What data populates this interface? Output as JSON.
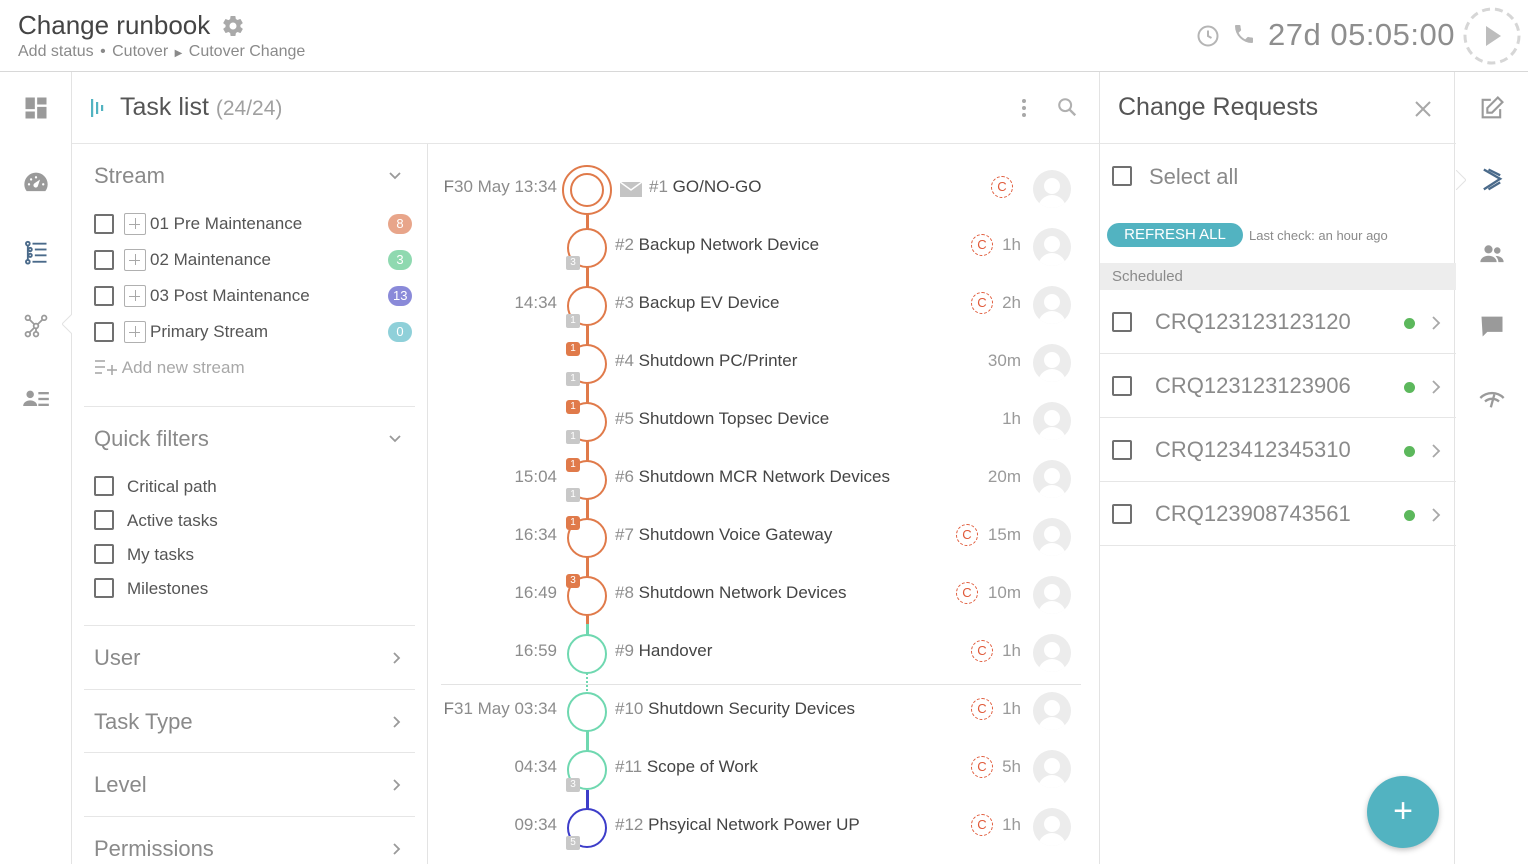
{
  "header": {
    "title": "Change runbook",
    "breadcrumb": [
      "Add status",
      "Cutover",
      "Cutover Change"
    ],
    "timer": "27d 05:05:00"
  },
  "tasklist": {
    "title": "Task list",
    "count": "(24/24)"
  },
  "filters": {
    "stream_title": "Stream",
    "streams": [
      {
        "label": "01 Pre Maintenance",
        "count": "8",
        "color": "#e8a58a"
      },
      {
        "label": "02 Maintenance",
        "count": "3",
        "color": "#8fd9b0"
      },
      {
        "label": "03 Post Maintenance",
        "count": "13",
        "color": "#8a8ad9"
      },
      {
        "label": "Primary Stream",
        "count": "0",
        "color": "#8fd0d9"
      }
    ],
    "add_stream": "Add new stream",
    "quick_title": "Quick filters",
    "quick": [
      "Critical path",
      "Active tasks",
      "My tasks",
      "Milestones"
    ],
    "sections": [
      "User",
      "Task Type",
      "Level",
      "Permissions"
    ]
  },
  "tasks": [
    {
      "date": "F",
      "time": "30 May 13:34",
      "num": "#1",
      "name": "GO/NO-GO",
      "dur": "",
      "c": true
    },
    {
      "date": "",
      "time": "",
      "num": "#2",
      "name": "Backup Network Device",
      "dur": "1h",
      "c": true
    },
    {
      "date": "",
      "time": "14:34",
      "num": "#3",
      "name": "Backup EV Device",
      "dur": "2h",
      "c": true
    },
    {
      "date": "",
      "time": "",
      "num": "#4",
      "name": "Shutdown PC/Printer",
      "dur": "30m",
      "c": false
    },
    {
      "date": "",
      "time": "",
      "num": "#5",
      "name": "Shutdown Topsec Device",
      "dur": "1h",
      "c": false
    },
    {
      "date": "",
      "time": "15:04",
      "num": "#6",
      "name": "Shutdown MCR Network Devices",
      "dur": "20m",
      "c": false
    },
    {
      "date": "",
      "time": "16:34",
      "num": "#7",
      "name": "Shutdown Voice Gateway",
      "dur": "15m",
      "c": true
    },
    {
      "date": "",
      "time": "16:49",
      "num": "#8",
      "name": "Shutdown Network Devices",
      "dur": "10m",
      "c": true
    },
    {
      "date": "",
      "time": "16:59",
      "num": "#9",
      "name": "Handover",
      "dur": "1h",
      "c": true
    },
    {
      "date": "F",
      "time": "31 May 03:34",
      "num": "#10",
      "name": "Shutdown Security Devices",
      "dur": "1h",
      "c": true
    },
    {
      "date": "",
      "time": "04:34",
      "num": "#11",
      "name": "Scope of Work",
      "dur": "5h",
      "c": true
    },
    {
      "date": "",
      "time": "09:34",
      "num": "#12",
      "name": "Phsyical Network Power UP",
      "dur": "1h",
      "c": true
    }
  ],
  "task_badges": {
    "r2": "3",
    "r3": "1",
    "r4a": "1",
    "r4b": "1",
    "r5a": "1",
    "r5b": "1",
    "r6a": "1",
    "r6b": "1",
    "r7": "1",
    "r8": "3",
    "r11": "3",
    "r12": "5"
  },
  "c_letter": "C",
  "change_requests": {
    "title": "Change Requests",
    "select_all": "Select all",
    "refresh": "REFRESH ALL",
    "last_check": "Last check: an hour ago",
    "section": "Scheduled",
    "items": [
      "CRQ123123123120",
      "CRQ123123123906",
      "CRQ123412345310",
      "CRQ123908743561"
    ]
  },
  "fab": "+",
  "colors": {
    "accent": "#52b3c1",
    "orange": "#e07a4a",
    "green": "#6fd8b0",
    "blue": "#3d3dc9"
  }
}
